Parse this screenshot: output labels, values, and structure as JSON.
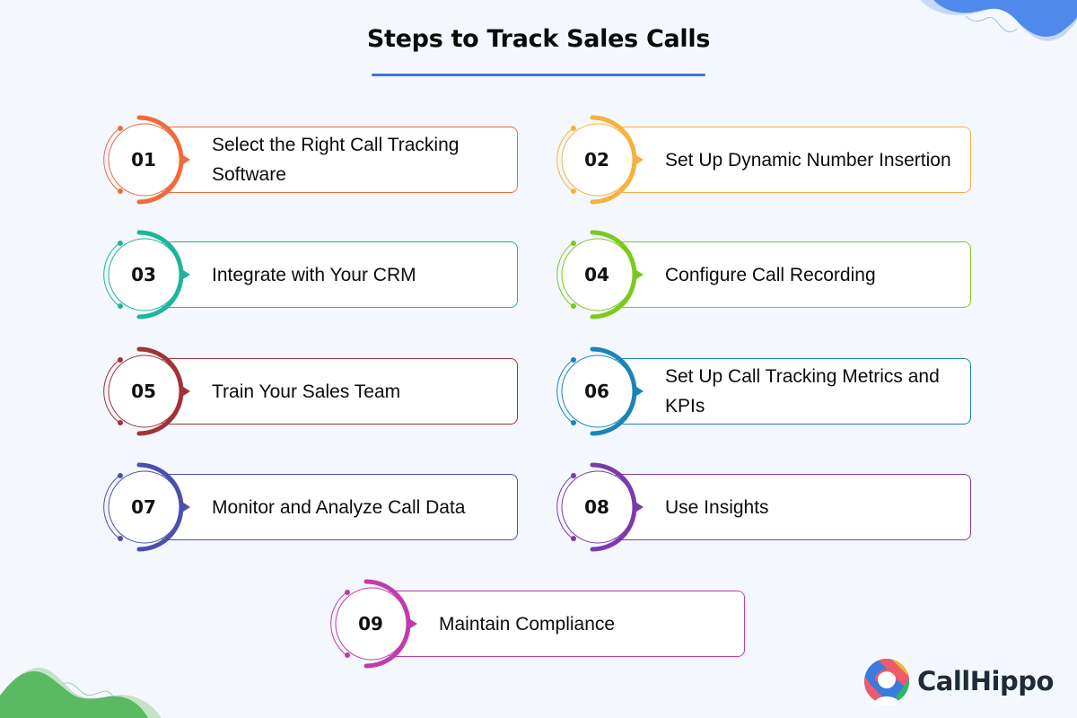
{
  "title": "Steps to Track Sales Calls",
  "colors": {
    "background": "#f4f8fe",
    "title_underline": "#3f73d9",
    "deco_top": "#5089ec",
    "deco_bottom": "#5bb863"
  },
  "steps": [
    {
      "number": "01",
      "text": "Select the Right Call Tracking Software",
      "color": "#f26a3a"
    },
    {
      "number": "02",
      "text": "Set Up Dynamic Number Insertion",
      "color": "#f7b23b"
    },
    {
      "number": "03",
      "text": "Integrate with Your CRM",
      "color": "#1fb59c"
    },
    {
      "number": "04",
      "text": "Configure Call Recording",
      "color": "#7cc91d"
    },
    {
      "number": "05",
      "text": "Train Your Sales Team",
      "color": "#a13338"
    },
    {
      "number": "06",
      "text": "Set Up Call Tracking Metrics and KPIs",
      "color": "#1a84b8"
    },
    {
      "number": "07",
      "text": "Monitor and Analyze Call Data",
      "color": "#4b4fad"
    },
    {
      "number": "08",
      "text": "Use Insights",
      "color": "#7b3aad"
    },
    {
      "number": "09",
      "text": "Maintain Compliance",
      "color": "#c23aad"
    }
  ],
  "logo": {
    "text": "CallHippo",
    "icon": "callhippo-headset-logo-icon"
  }
}
